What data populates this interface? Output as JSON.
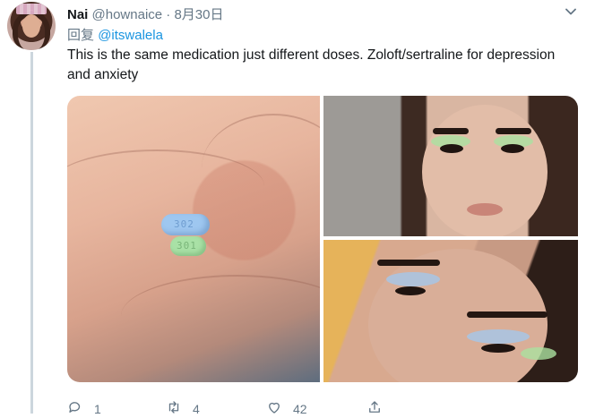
{
  "tweet": {
    "display_name": "Nai",
    "handle": "@hownaice",
    "separator": "·",
    "date": "8月30日",
    "reply_prefix": "回复",
    "reply_mention": "@itswalela",
    "text": "This is the same medication just different doses. Zoloft/sertraline for depression and anxiety"
  },
  "media": {
    "photo1": {
      "pill_blue_imprint": "302",
      "pill_green_imprint": "301"
    }
  },
  "actions": {
    "reply_count": "1",
    "retweet_count": "4",
    "like_count": "42"
  },
  "colors": {
    "link": "#1b95e0",
    "secondary_text": "#657786",
    "thread_line": "#ccd6dd"
  },
  "icons": [
    "chevron-down-icon",
    "reply-icon",
    "retweet-icon",
    "like-icon",
    "share-icon"
  ]
}
